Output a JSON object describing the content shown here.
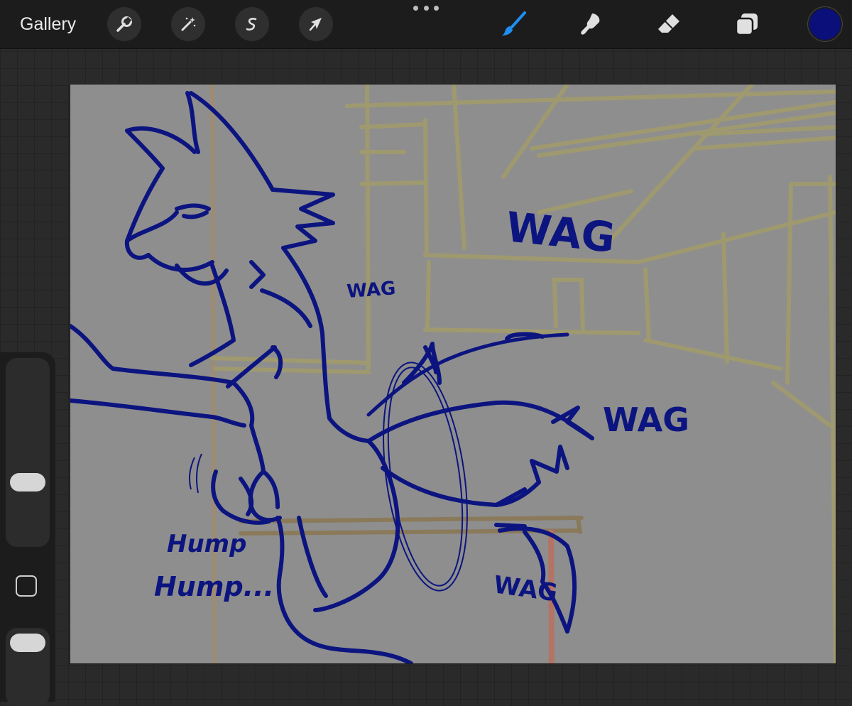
{
  "toolbar": {
    "gallery_label": "Gallery",
    "left_tools": [
      {
        "name": "wrench-icon",
        "label": "Actions"
      },
      {
        "name": "magic-wand-icon",
        "label": "Adjustments"
      },
      {
        "name": "selection-icon",
        "label": "Selection"
      },
      {
        "name": "arrow-cursor-icon",
        "label": "Transform"
      }
    ],
    "right_tools": [
      {
        "name": "brush-icon",
        "active": true
      },
      {
        "name": "smudge-icon",
        "active": false
      },
      {
        "name": "eraser-icon",
        "active": false
      },
      {
        "name": "layers-icon",
        "active": false
      }
    ],
    "current_color": "#0a0f7a",
    "active_tool_color": "#1e8ef2"
  },
  "canvas": {
    "background": "#8e8e8e",
    "ink_color": "#0c1480",
    "sketch_color": "#a39c6a",
    "texts": {
      "wag_big": "WAG",
      "wag_small": "WAG",
      "wag_right": "WAG",
      "wag_bottom": "WAG",
      "hump_1": "Hump",
      "hump_2": "Hump..."
    }
  },
  "sidebar": {
    "brush_size_level": 0.3,
    "opacity_level": 0.9
  }
}
